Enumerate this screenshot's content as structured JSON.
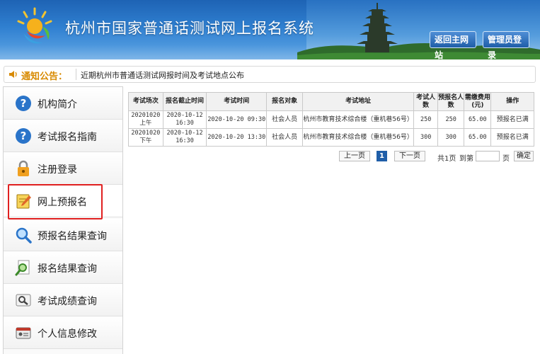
{
  "header": {
    "title": "杭州市国家普通话测试网上报名系统",
    "home_button": "返回主网站",
    "admin_button": "管理员登录"
  },
  "notice": {
    "label": "通知公告：",
    "text": "近期杭州市普通话测试网报时间及考试地点公布"
  },
  "sidebar": {
    "items": [
      {
        "label": "机构简介",
        "icon": "question-icon"
      },
      {
        "label": "考试报名指南",
        "icon": "question-icon"
      },
      {
        "label": "注册登录",
        "icon": "lock-icon"
      },
      {
        "label": "网上预报名",
        "icon": "notepad-pencil-icon"
      },
      {
        "label": "预报名结果查询",
        "icon": "magnifier-icon"
      },
      {
        "label": "报名结果查询",
        "icon": "magnifier-document-icon"
      },
      {
        "label": "考试成绩查询",
        "icon": "search-card-icon"
      },
      {
        "label": "个人信息修改",
        "icon": "id-card-icon"
      }
    ],
    "selected": "网上预报名"
  },
  "table": {
    "headers": [
      "考试场次",
      "报名截止时间",
      "考试时间",
      "报名对象",
      "考试地址",
      "考试人数",
      "预报名人数",
      "需缴费用(元)",
      "操作"
    ],
    "rows": [
      {
        "session": "20201020上午",
        "deadline": "2020-10-12 16:30",
        "exam_time": "2020-10-20 09:30",
        "target": "社会人员",
        "address": "杭州市教育技术综合楼（重机巷56号）",
        "capacity": "250",
        "pre_registered": "250",
        "fee": "65.00",
        "action": "预报名已满"
      },
      {
        "session": "20201020下午",
        "deadline": "2020-10-12 16:30",
        "exam_time": "2020-10-20 13:30",
        "target": "社会人员",
        "address": "杭州市教育技术综合楼（重机巷56号）",
        "capacity": "300",
        "pre_registered": "300",
        "fee": "65.00",
        "action": "预报名已满"
      }
    ]
  },
  "pager": {
    "prev": "上一页",
    "current": "1",
    "next": "下一页",
    "total": "共1页",
    "goto_prefix": "到第",
    "goto_suffix": "页",
    "confirm": "确定"
  },
  "colors": {
    "header_blue": "#2f7fd0",
    "notice_orange": "#d88a00",
    "highlight_red": "#e02020",
    "pager_current": "#1f5ea8"
  }
}
